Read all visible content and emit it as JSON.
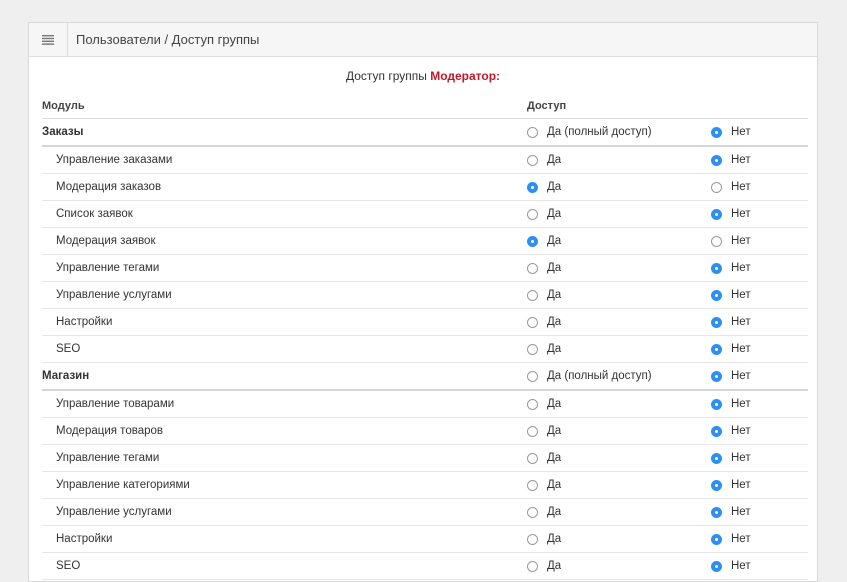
{
  "header": {
    "menu_icon": "menu-icon",
    "breadcrumb": "Пользователи / Доступ группы"
  },
  "caption": {
    "prefix": "Доступ группы",
    "group_name": "Модератор:"
  },
  "table": {
    "col_module": "Модуль",
    "col_access": "Доступ"
  },
  "colors": {
    "accent": "#2d8ff2",
    "group_name": "#c0182b"
  },
  "groups": [
    {
      "title": "Заказы",
      "yes_label": "Да (полный доступ)",
      "no_label": "Нет",
      "selected": "no",
      "items": [
        {
          "label": "Управление заказами",
          "yes_label": "Да",
          "no_label": "Нет",
          "selected": "no"
        },
        {
          "label": "Модерация заказов",
          "yes_label": "Да",
          "no_label": "Нет",
          "selected": "yes"
        },
        {
          "label": "Список заявок",
          "yes_label": "Да",
          "no_label": "Нет",
          "selected": "no"
        },
        {
          "label": "Модерация заявок",
          "yes_label": "Да",
          "no_label": "Нет",
          "selected": "yes"
        },
        {
          "label": "Управление тегами",
          "yes_label": "Да",
          "no_label": "Нет",
          "selected": "no"
        },
        {
          "label": "Управление услугами",
          "yes_label": "Да",
          "no_label": "Нет",
          "selected": "no"
        },
        {
          "label": "Настройки",
          "yes_label": "Да",
          "no_label": "Нет",
          "selected": "no"
        },
        {
          "label": "SEO",
          "yes_label": "Да",
          "no_label": "Нет",
          "selected": "no"
        }
      ]
    },
    {
      "title": "Магазин",
      "yes_label": "Да (полный доступ)",
      "no_label": "Нет",
      "selected": "no",
      "items": [
        {
          "label": "Управление товарами",
          "yes_label": "Да",
          "no_label": "Нет",
          "selected": "no"
        },
        {
          "label": "Модерация товаров",
          "yes_label": "Да",
          "no_label": "Нет",
          "selected": "no"
        },
        {
          "label": "Управление тегами",
          "yes_label": "Да",
          "no_label": "Нет",
          "selected": "no"
        },
        {
          "label": "Управление категориями",
          "yes_label": "Да",
          "no_label": "Нет",
          "selected": "no"
        },
        {
          "label": "Управление услугами",
          "yes_label": "Да",
          "no_label": "Нет",
          "selected": "no"
        },
        {
          "label": "Настройки",
          "yes_label": "Да",
          "no_label": "Нет",
          "selected": "no"
        },
        {
          "label": "SEO",
          "yes_label": "Да",
          "no_label": "Нет",
          "selected": "no"
        }
      ]
    }
  ]
}
